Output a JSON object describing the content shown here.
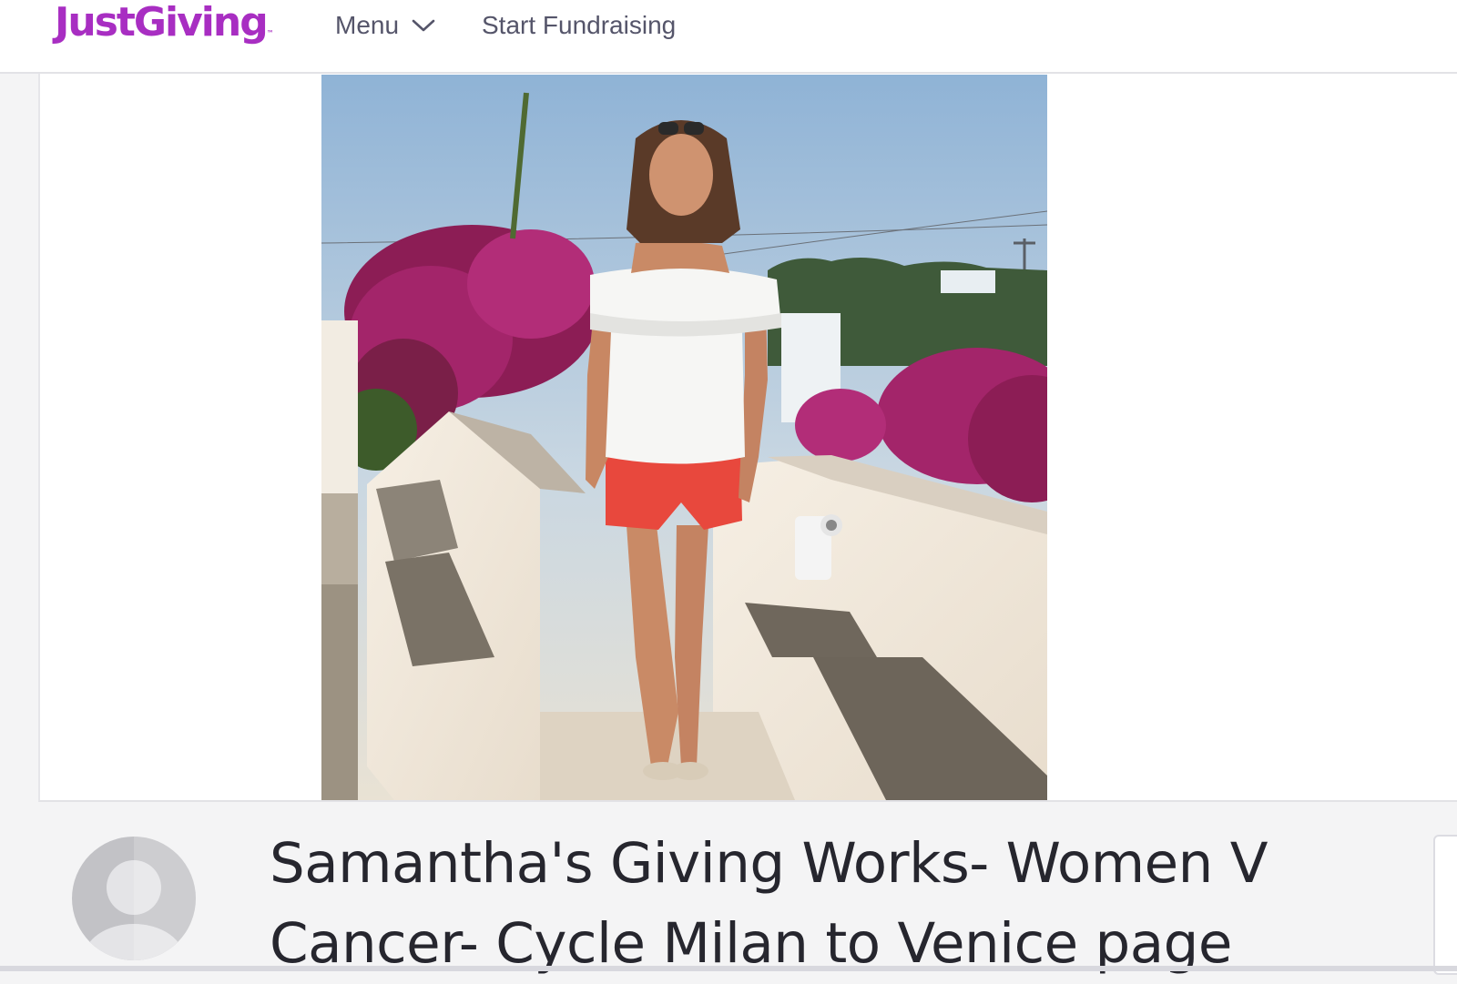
{
  "header": {
    "logo_text": "JustGiving",
    "logo_tm": "™",
    "menu_label": "Menu",
    "start_label": "Start Fundraising"
  },
  "hero": {
    "photo_alt": "Samantha's fundraising page photo"
  },
  "page": {
    "title": "Samantha's Giving Works- Women V Cancer- Cycle Milan to Venice page"
  },
  "colors": {
    "brand": "#a82ec2",
    "nav_text": "#55556a",
    "title_text": "#26262e"
  },
  "icons": {
    "menu_chevron": "chevron-down-icon",
    "avatar": "user-avatar-icon"
  }
}
